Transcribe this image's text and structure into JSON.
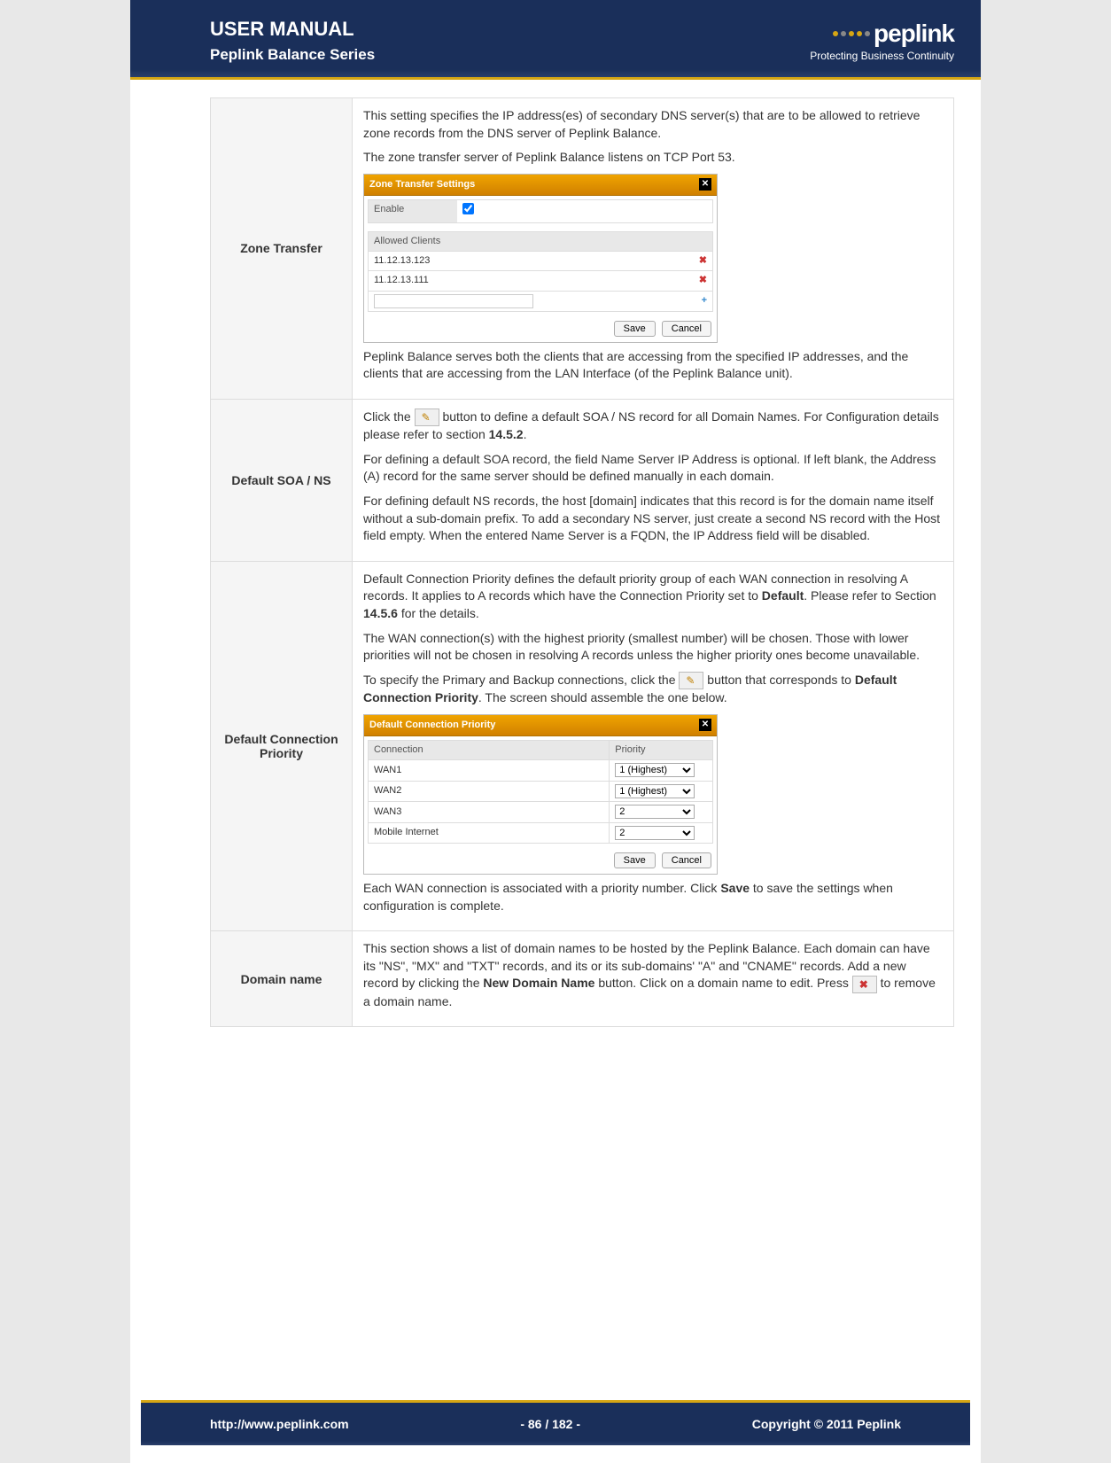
{
  "header": {
    "title": "USER MANUAL",
    "subtitle": "Peplink Balance Series",
    "brand": "peplink",
    "tagline": "Protecting Business Continuity"
  },
  "rows": {
    "zone_transfer": {
      "label": "Zone Transfer",
      "p1": "This setting specifies the IP address(es) of secondary DNS server(s) that are to be allowed to retrieve zone records from the DNS server of Peplink Balance.",
      "p2": "The zone transfer server of Peplink Balance listens on TCP Port 53.",
      "dialog": {
        "title": "Zone Transfer Settings",
        "enable_label": "Enable",
        "clients_label": "Allowed Clients",
        "clients": [
          "11.12.13.123",
          "11.12.13.111"
        ],
        "save": "Save",
        "cancel": "Cancel"
      },
      "p3": "Peplink Balance serves both the clients that are accessing from the specified IP addresses, and the clients that are accessing from the LAN Interface (of the Peplink Balance unit)."
    },
    "default_soa": {
      "label": "Default SOA / NS",
      "p1a": "Click the ",
      "p1b": " button to define a default SOA / NS record for all Domain Names. For Configuration details please refer to section ",
      "p1c": "14.5.2",
      "p1d": ".",
      "p2": "For defining a default SOA record, the field Name Server IP Address is optional.  If left blank, the Address (A) record for the same server should be defined manually in each domain.",
      "p3": "For defining default NS records, the host [domain] indicates that this record is for the domain name itself without a sub-domain prefix.  To add a secondary NS server, just create a second NS record with the Host field empty. When the entered Name Server is a FQDN, the IP Address field will be disabled."
    },
    "default_conn": {
      "label": "Default Connection Priority",
      "p1a": "Default Connection Priority defines the default priority group of each WAN connection in resolving A records. It applies to A records which have the Connection Priority set to ",
      "p1b": "Default",
      "p1c": ".  Please refer to Section ",
      "p1d": "14.5.6",
      "p1e": " for the details.",
      "p2": "The WAN connection(s) with the highest priority (smallest number) will be chosen. Those with lower priorities will not be chosen in resolving A records unless the higher priority ones become unavailable.",
      "p3a": "To specify the Primary and Backup connections, click the ",
      "p3b": " button that corresponds to ",
      "p3c": "Default Connection Priority",
      "p3d": ". The screen should assemble the one below.",
      "dialog": {
        "title": "Default Connection Priority",
        "col_conn": "Connection",
        "col_prio": "Priority",
        "rows": [
          {
            "conn": "WAN1",
            "prio": "1 (Highest)"
          },
          {
            "conn": "WAN2",
            "prio": "1 (Highest)"
          },
          {
            "conn": "WAN3",
            "prio": "2"
          },
          {
            "conn": "Mobile Internet",
            "prio": "2"
          }
        ],
        "save": "Save",
        "cancel": "Cancel"
      },
      "p4a": "Each WAN connection is associated with a priority number.  Click ",
      "p4b": "Save",
      "p4c": " to save the settings when configuration is complete."
    },
    "domain_name": {
      "label": "Domain name",
      "p1a": "This section shows a list of domain names to be hosted by the Peplink Balance.  Each domain can have its \"NS\", \"MX\" and \"TXT\" records, and its or its sub-domains' \"A\" and \"CNAME\" records. Add a new record by clicking the ",
      "p1b": "New Domain Name",
      "p1c": " button. Click on a domain name to edit. Press ",
      "p1d": " to remove a domain name."
    }
  },
  "footer": {
    "url": "http://www.peplink.com",
    "page": "- 86 / 182 -",
    "copyright": "Copyright © 2011 Peplink"
  }
}
